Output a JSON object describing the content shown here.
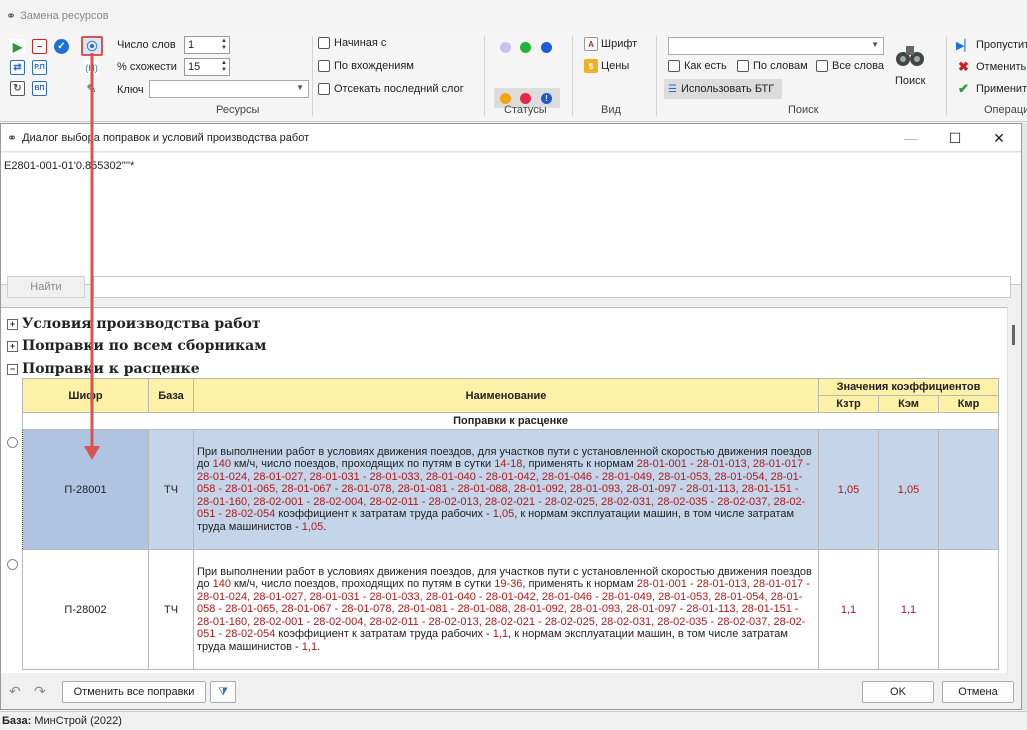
{
  "app": {
    "title": "Замена ресурсов"
  },
  "ribbon": {
    "word_count_label": "Число слов",
    "word_count_value": "1",
    "similarity_label": "% схожести",
    "similarity_value": "15",
    "key_label": "Ключ",
    "key_value": "",
    "resources_group": "Ресурсы",
    "chk_starts_with": "Начиная с",
    "chk_by_occurrence": "По вхождениям",
    "chk_cut_last": "Отсекать последний слог",
    "statuses_group": "Статусы",
    "font_btn": "Шрифт",
    "prices_btn": "Цены",
    "view_group": "Вид",
    "search_value": "",
    "chk_as_is": "Как есть",
    "chk_by_words": "По словам",
    "chk_all_words": "Все слова",
    "use_btg": "Использовать БТГ",
    "search_btn": "Поиск",
    "search_group": "Поиск",
    "skip_btn": "Пропустить",
    "cancel_btn": "Отменить",
    "apply_btn": "Применить",
    "operations_group": "Операции",
    "icon_hex_label": "(H)",
    "icon_rp_label": "Р.П",
    "icon_vp_label": "ВП",
    "status_colors": {
      "lavender": "#c6c3f0",
      "green": "#1fb53a",
      "blue": "#1e5bd6",
      "orange": "#f2a50c",
      "red": "#e8264a",
      "info": "#1e5bd6"
    }
  },
  "dialog": {
    "title": "Диалог выбора поправок и условий производства работ",
    "code": "Е2801-001-01'0.855302''''*",
    "find_btn": "Найти",
    "find_value": "",
    "sections": [
      {
        "label": "Условия производства работ",
        "toggle": "+"
      },
      {
        "label": "Поправки по всем сборникам",
        "toggle": "+"
      },
      {
        "label": "Поправки к расценке",
        "toggle": "−"
      }
    ],
    "table": {
      "headers": {
        "shifr": "Шифр",
        "baza": "База",
        "name": "Наименование",
        "coef_group": "Значения коэффициентов",
        "kztr": "Кзтр",
        "kem": "Кэм",
        "kmr": "Кмр"
      },
      "subheader": "Поправки к расценке",
      "rows": [
        {
          "shifr": "П-28001",
          "baza": "ТЧ",
          "desc_start": "При выполнении работ в условиях движения поездов, для участков пути с установленной скоростью движения поездов до ",
          "speed": "140",
          "desc_mid1": " км/ч, число поездов, проходящих по путям в сутки ",
          "trains": "14-18",
          "desc_mid2": ", применять к нормам ",
          "codes": "28-01-001 - 28-01-013, 28-01-017 - 28-01-024, 28-01-027, 28-01-031 - 28-01-033, 28-01-040 - 28-01-042, 28-01-046 - 28-01-049, 28-01-053, 28-01-054, 28-01-058 - 28-01-065, 28-01-067 - 28-01-078, 28-01-081 - 28-01-088, 28-01-092, 28-01-093, 28-01-097 - 28-01-113, 28-01-151 - 28-01-160, 28-02-001 - 28-02-004, 28-02-011 - 28-02-013, 28-02-021 - 28-02-025, 28-02-031, 28-02-035 - 28-02-037, 28-02-051 - 28-02-054",
          "desc_mid3": " коэффициент к затратам труда рабочих - ",
          "k1": "1,05",
          "desc_mid4": ", к нормам эксплуатации машин, в том числе затратам труда машинистов - ",
          "k2": "1,05",
          "desc_end": ".",
          "kztr": "1,05",
          "kem": "1,05",
          "kmr": "",
          "selected": true
        },
        {
          "shifr": "П-28002",
          "baza": "ТЧ",
          "desc_start": "При выполнении работ в условиях движения поездов, для участков пути с установленной скоростью движения поездов до ",
          "speed": "140",
          "desc_mid1": " км/ч, число поездов, проходящих по путям в сутки ",
          "trains": "19-36",
          "desc_mid2": ", применять к нормам ",
          "codes": "28-01-001 - 28-01-013, 28-01-017 - 28-01-024, 28-01-027, 28-01-031 - 28-01-033, 28-01-040 - 28-01-042, 28-01-046 - 28-01-049, 28-01-053, 28-01-054, 28-01-058 - 28-01-065, 28-01-067 - 28-01-078, 28-01-081 - 28-01-088, 28-01-092, 28-01-093, 28-01-097 - 28-01-113, 28-01-151 - 28-01-160, 28-02-001 - 28-02-004, 28-02-011 - 28-02-013, 28-02-021 - 28-02-025, 28-02-031, 28-02-035 - 28-02-037, 28-02-051 - 28-02-054",
          "desc_mid3": " коэффициент к затратам труда рабочих - ",
          "k1": "1,1",
          "desc_mid4": ", к нормам эксплуатации машин, в том числе затратам труда машинистов - ",
          "k2": "1,1",
          "desc_end": ".",
          "kztr": "1,1",
          "kem": "1,1",
          "kmr": "",
          "selected": false
        }
      ]
    },
    "cancel_all_btn": "Отменить все поправки",
    "ok_btn": "OK",
    "cancel_btn": "Отмена"
  },
  "statusbar": {
    "base_label": "База:",
    "base_value": "МинСтрой (2022)"
  },
  "annotation_color": "#d9534f"
}
